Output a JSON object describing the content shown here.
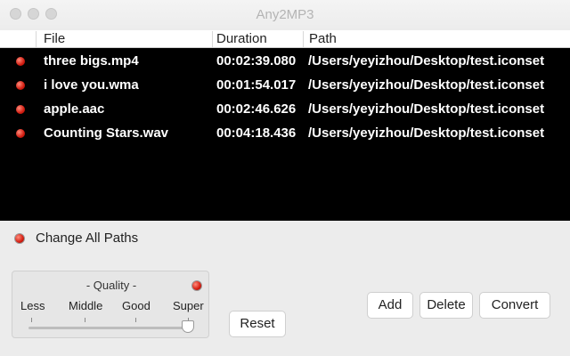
{
  "window": {
    "title": "Any2MP3"
  },
  "table": {
    "columns": [
      "File",
      "Duration",
      "Path"
    ],
    "rows": [
      {
        "file": "three bigs.mp4",
        "duration": "00:02:39.080",
        "path": "/Users/yeyizhou/Desktop/test.iconset"
      },
      {
        "file": "i love you.wma",
        "duration": "00:01:54.017",
        "path": "/Users/yeyizhou/Desktop/test.iconset"
      },
      {
        "file": "apple.aac",
        "duration": "00:02:46.626",
        "path": "/Users/yeyizhou/Desktop/test.iconset"
      },
      {
        "file": "Counting Stars.wav",
        "duration": "00:04:18.436",
        "path": "/Users/yeyizhou/Desktop/test.iconset"
      }
    ]
  },
  "change_all_paths": {
    "label": "Change All Paths"
  },
  "quality": {
    "title": "- Quality -",
    "levels": [
      "Less",
      "Middle",
      "Good",
      "Super"
    ],
    "selected": "Super"
  },
  "buttons": {
    "reset": "Reset",
    "add": "Add",
    "delete": "Delete",
    "convert": "Convert"
  },
  "colors": {
    "indicator": "#d21c10",
    "table_background": "#000000"
  }
}
